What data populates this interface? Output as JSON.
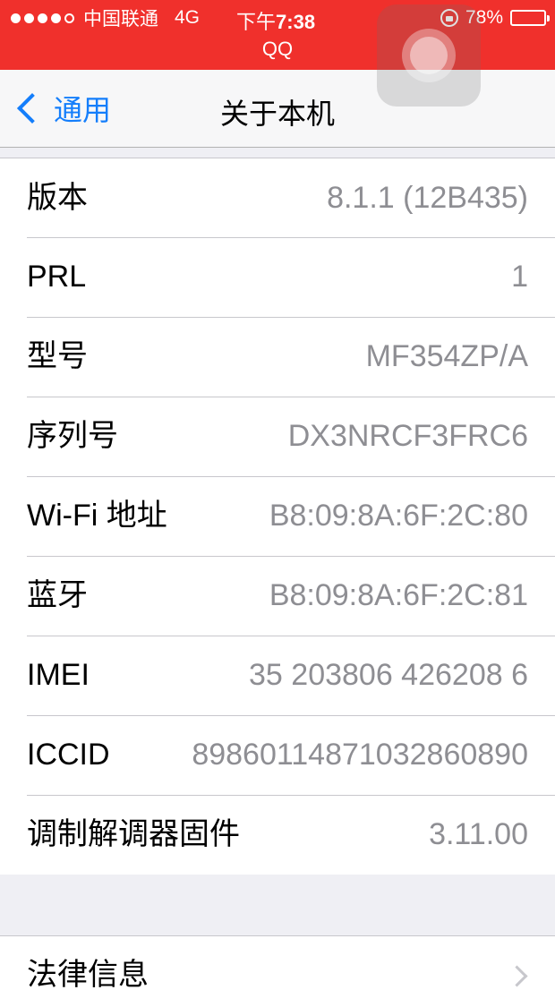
{
  "status_bar": {
    "carrier": "中国联通",
    "network": "4G",
    "time_prefix": "下午",
    "time": "7:38",
    "battery": "78%",
    "battery_level": 0.78,
    "app_label": "QQ",
    "signal_bars": 4
  },
  "nav": {
    "back_label": "通用",
    "title": "关于本机"
  },
  "rows": [
    {
      "label": "版本",
      "value": "8.1.1 (12B435)"
    },
    {
      "label": "PRL",
      "value": "1"
    },
    {
      "label": "型号",
      "value": "MF354ZP/A"
    },
    {
      "label": "序列号",
      "value": "DX3NRCF3FRC6"
    },
    {
      "label": "Wi-Fi 地址",
      "value": "B8:09:8A:6F:2C:80"
    },
    {
      "label": "蓝牙",
      "value": "B8:09:8A:6F:2C:81"
    },
    {
      "label": "IMEI",
      "value": "35 203806 426208 6"
    },
    {
      "label": "ICCID",
      "value": "89860114871032860890"
    },
    {
      "label": "调制解调器固件",
      "value": "3.11.00"
    }
  ],
  "legal": {
    "label": "法律信息"
  },
  "colors": {
    "status_bar_bg": "#f0302c",
    "accent": "#147efb",
    "value_text": "#8e8e93"
  },
  "icons": [
    "signal-dots-icon",
    "lock-rotation-icon",
    "battery-icon",
    "chevron-left-icon",
    "chevron-right-icon",
    "assistive-touch-icon"
  ]
}
